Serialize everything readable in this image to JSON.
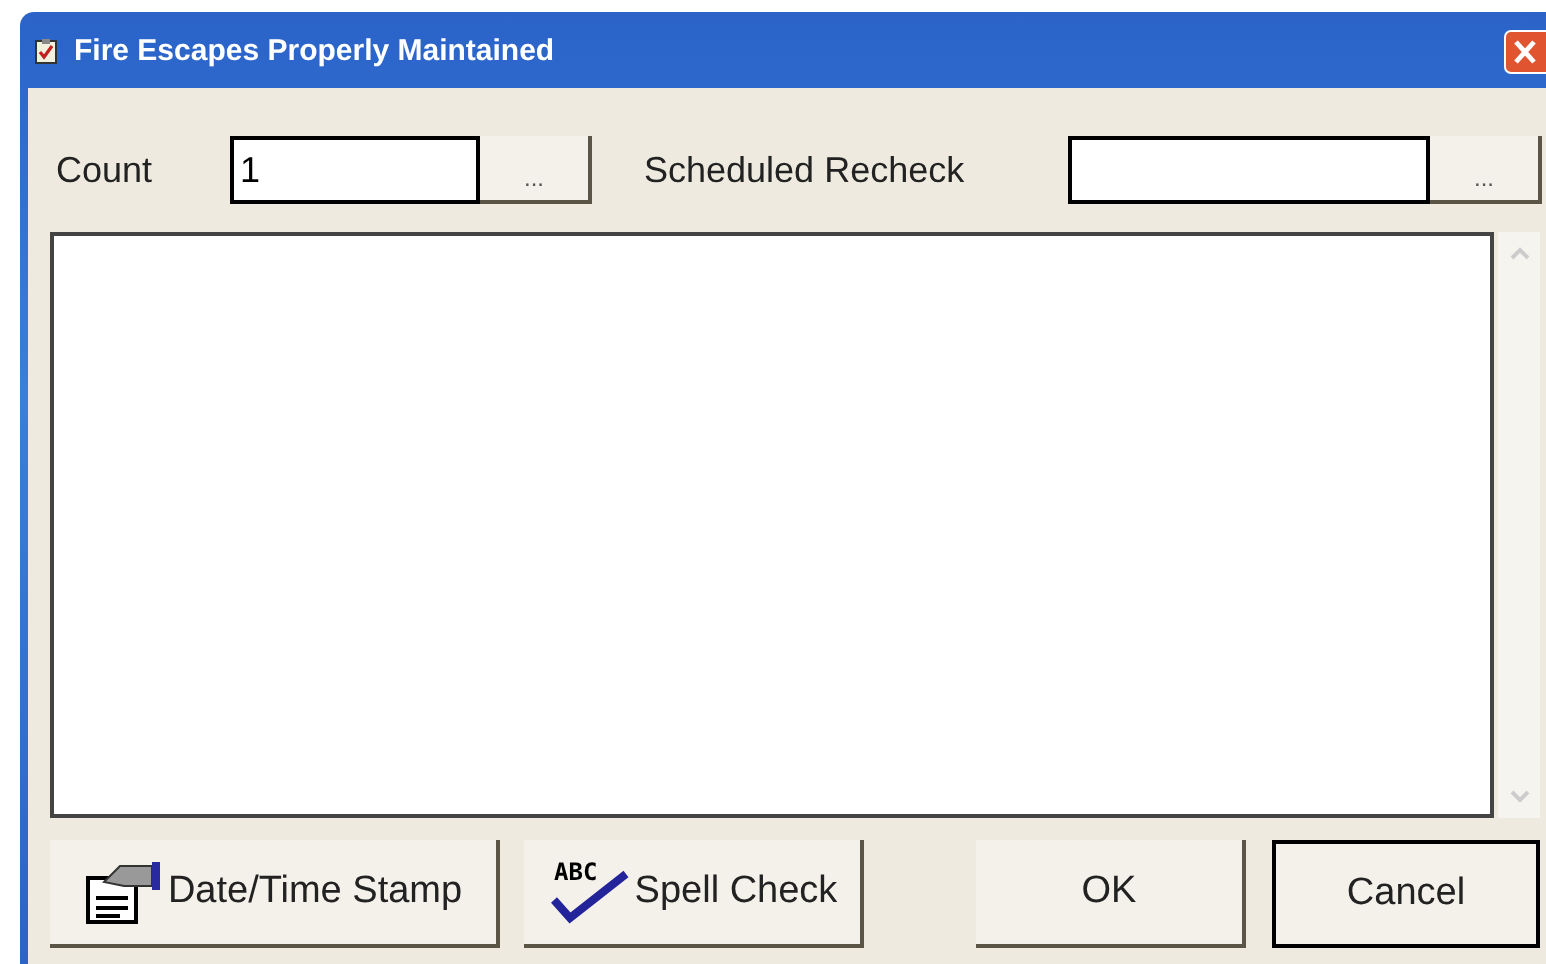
{
  "window": {
    "title": "Fire Escapes Properly Maintained"
  },
  "fields": [
    {
      "label": "Count",
      "value": "1",
      "browse": "..."
    },
    {
      "label": "Scheduled Recheck",
      "browse": "..."
    }
  ],
  "buttons": [
    {
      "kind": "stamp",
      "label": "Date/Time Stamp",
      "default": false
    },
    {
      "kind": "spell",
      "label": "Spell Check",
      "icon_text": "ABC",
      "default": false
    },
    {
      "kind": "plain",
      "label": "OK",
      "default": false
    },
    {
      "kind": "plain",
      "label": "Cancel",
      "default": true
    }
  ]
}
